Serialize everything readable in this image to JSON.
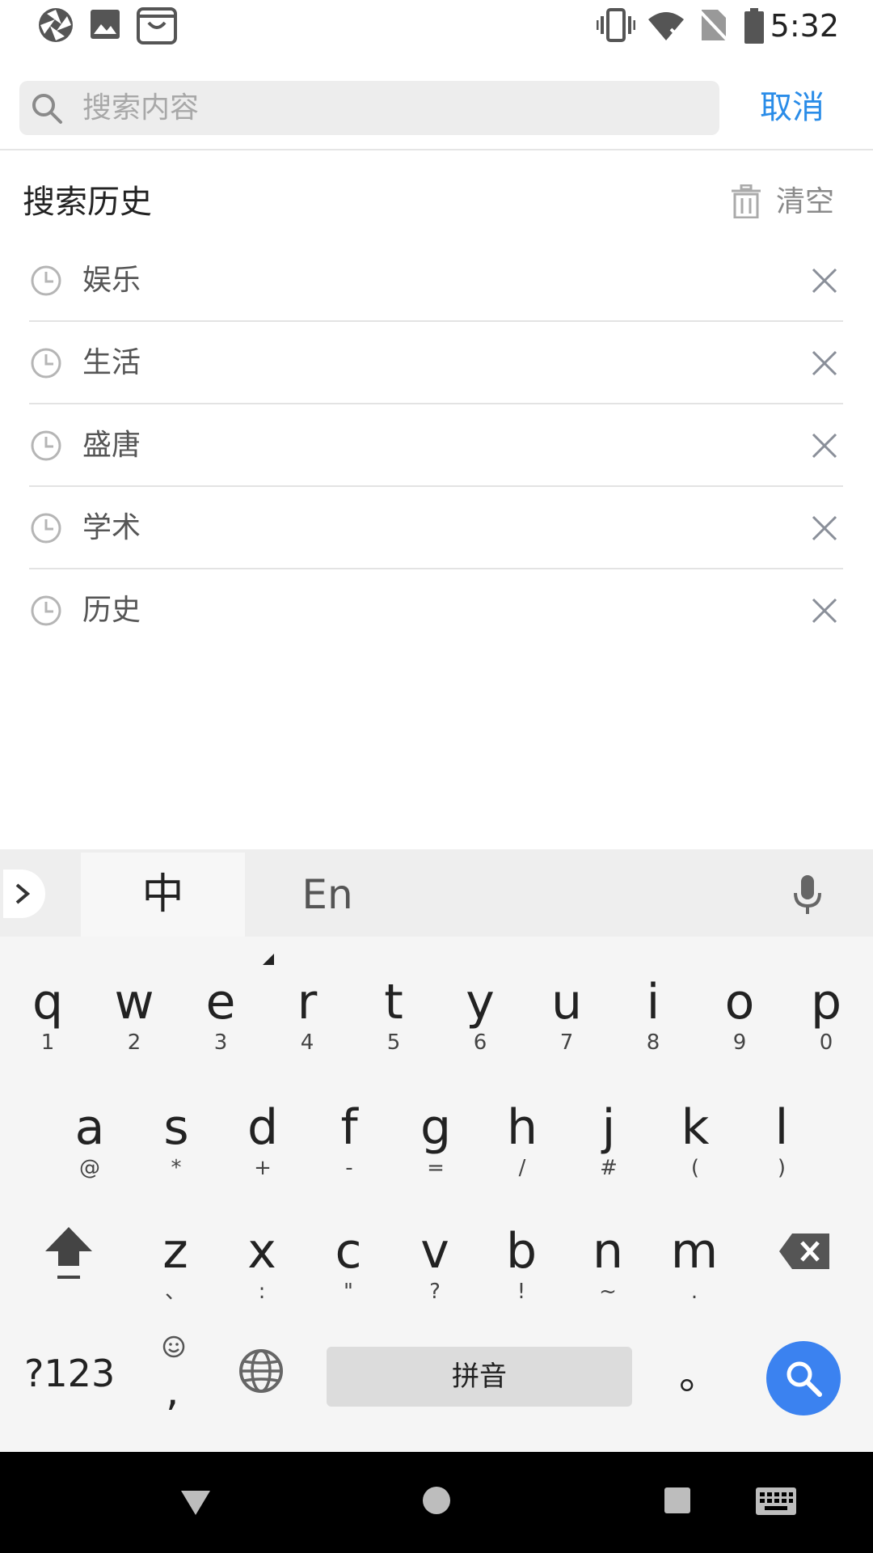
{
  "status_bar": {
    "time": "5:32",
    "left_icons": [
      "aperture-icon",
      "image-icon",
      "shopping-bag-icon"
    ],
    "right_icons": [
      "vibrate-icon",
      "wifi-icon",
      "no-sim-icon",
      "battery-icon"
    ]
  },
  "search": {
    "placeholder": "搜索内容",
    "cancel_label": "取消",
    "accent_color": "#2a8ce8"
  },
  "history": {
    "title": "搜索历史",
    "clear_label": "清空",
    "items": [
      {
        "label": "娱乐"
      },
      {
        "label": "生活"
      },
      {
        "label": "盛唐"
      },
      {
        "label": "学术"
      },
      {
        "label": "历史"
      }
    ]
  },
  "keyboard": {
    "tab_zh": "中",
    "tab_en": "En",
    "row1": [
      {
        "main": "q",
        "sub": "1"
      },
      {
        "main": "w",
        "sub": "2"
      },
      {
        "main": "e",
        "sub": "3"
      },
      {
        "main": "r",
        "sub": "4"
      },
      {
        "main": "t",
        "sub": "5"
      },
      {
        "main": "y",
        "sub": "6"
      },
      {
        "main": "u",
        "sub": "7"
      },
      {
        "main": "i",
        "sub": "8"
      },
      {
        "main": "o",
        "sub": "9"
      },
      {
        "main": "p",
        "sub": "0"
      }
    ],
    "row2": [
      {
        "main": "a",
        "sub": "@"
      },
      {
        "main": "s",
        "sub": "*"
      },
      {
        "main": "d",
        "sub": "+"
      },
      {
        "main": "f",
        "sub": "-"
      },
      {
        "main": "g",
        "sub": "="
      },
      {
        "main": "h",
        "sub": "/"
      },
      {
        "main": "j",
        "sub": "#"
      },
      {
        "main": "k",
        "sub": "("
      },
      {
        "main": "l",
        "sub": ")"
      }
    ],
    "row3": [
      {
        "main": "z",
        "sub": "、"
      },
      {
        "main": "x",
        "sub": ":"
      },
      {
        "main": "c",
        "sub": "\""
      },
      {
        "main": "v",
        "sub": "?"
      },
      {
        "main": "b",
        "sub": "!"
      },
      {
        "main": "n",
        "sub": "~"
      },
      {
        "main": "m",
        "sub": "."
      }
    ],
    "key_123": "?123",
    "key_comma": ",",
    "space_label": "拼音",
    "key_period": "。",
    "search_key_color": "#3b82f0"
  },
  "nav_bar": {
    "icons": [
      "back-icon",
      "home-icon",
      "recents-icon",
      "keyboard-switch-icon"
    ]
  }
}
